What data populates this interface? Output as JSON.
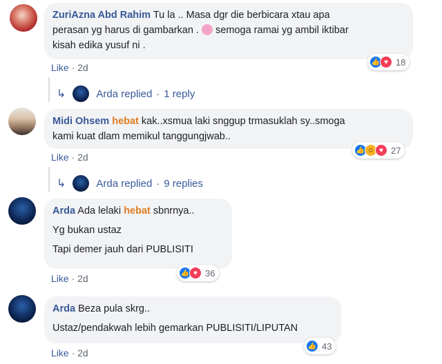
{
  "comments": [
    {
      "author": "ZuriAzna Abd Rahim",
      "text_1": "Tu la .. Masa dgr die berbicara xtau apa",
      "text_2a": "perasan yg harus di gambarkan .",
      "text_2b": "semoga ramai yg ambil iktibar",
      "text_3": "kisah edika yusuf ni .",
      "like_label": "Like",
      "time": "2d",
      "reaction_count": "18",
      "reactions": [
        "like",
        "love"
      ],
      "reply": {
        "name": "Arda",
        "verb": "replied",
        "count": "1 reply"
      }
    },
    {
      "author": "Midi Ohsem",
      "highlight": "hebat",
      "text_1": "kak..xsmua laki snggup trmasuklah sy..smoga",
      "text_2": "kami kuat dlam memikul tanggungjwab..",
      "like_label": "Like",
      "time": "2d",
      "reaction_count": "27",
      "reactions": [
        "like",
        "haha",
        "love"
      ],
      "reply": {
        "name": "Arda",
        "verb": "replied",
        "count": "9 replies"
      }
    },
    {
      "author": "Arda",
      "text_1a": "Ada lelaki",
      "highlight": "hebat",
      "text_1b": "sbnrnya..",
      "text_2": "Yg bukan ustaz",
      "text_3": "Tapi demer jauh dari PUBLISITI",
      "like_label": "Like",
      "time": "2d",
      "reaction_count": "36",
      "reactions": [
        "like",
        "love"
      ]
    },
    {
      "author": "Arda",
      "text_1": "Beza pula skrg..",
      "text_2": "Ustaz/pendakwah lebih gemarkan PUBLISITI/LIPUTAN",
      "like_label": "Like",
      "time": "2d",
      "reaction_count": "43",
      "reactions": [
        "like"
      ]
    }
  ],
  "separator": "·",
  "colors": {
    "link": "#385898",
    "highlight": "#e07c20",
    "bubble": "#f2f3f5"
  }
}
